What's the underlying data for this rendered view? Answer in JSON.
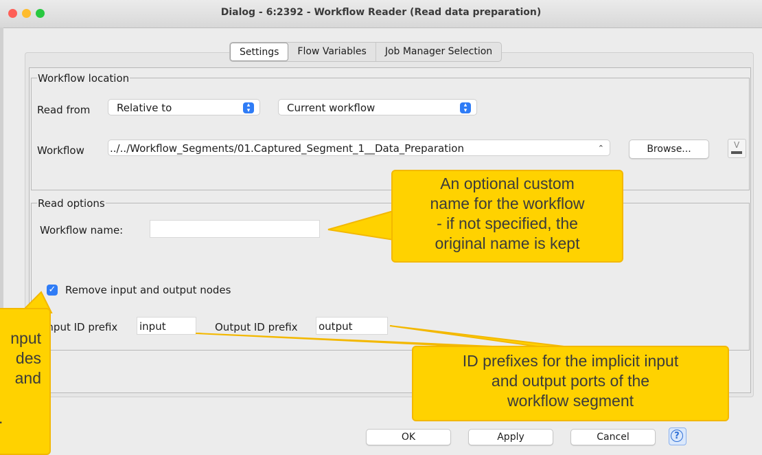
{
  "window": {
    "title": "Dialog - 6:2392 - Workflow Reader (Read data preparation)"
  },
  "tabs": [
    {
      "label": "Settings",
      "active": true
    },
    {
      "label": "Flow Variables",
      "active": false
    },
    {
      "label": "Job Manager Selection",
      "active": false
    }
  ],
  "workflow_location": {
    "legend": "Workflow location",
    "read_from_label": "Read from",
    "read_from_value": "Relative to",
    "relative_to_value": "Current workflow",
    "workflow_label": "Workflow",
    "workflow_path": "../../Workflow_Segments/01.Captured_Segment_1__Data_Preparation",
    "browse_label": "Browse...",
    "flow_var_icon_label": "V"
  },
  "read_options": {
    "legend": "Read options",
    "workflow_name_label": "Workflow name:",
    "workflow_name_value": "",
    "remove_nodes_label": "Remove input and output nodes",
    "remove_nodes_checked": true,
    "input_prefix_label": "Input ID prefix",
    "input_prefix_value": "input",
    "output_prefix_label": "Output ID prefix",
    "output_prefix_value": "output"
  },
  "buttons": {
    "ok": "OK",
    "apply": "Apply",
    "cancel": "Cancel",
    "help": "?"
  },
  "callouts": {
    "name": [
      "An optional custom",
      "name for the workflow",
      "- if not specified, the",
      "original name is kept"
    ],
    "prefix": [
      "ID prefixes for the implicit input",
      "and output ports of the",
      "workflow segment"
    ],
    "remove_partial": [
      "nput",
      "des",
      "and",
      "."
    ]
  },
  "colors": {
    "accent": "#2f7cf6",
    "callout_fill": "#ffd200",
    "callout_border": "#f3b800",
    "close": "#fe5f57",
    "minimize": "#febc2e",
    "zoom": "#28c840"
  }
}
